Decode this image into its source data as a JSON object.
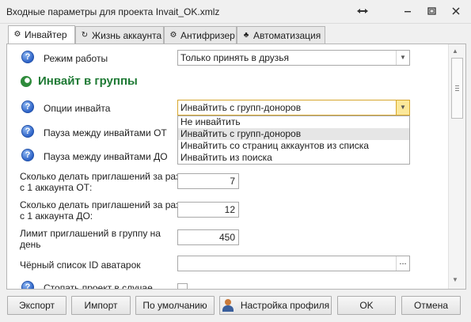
{
  "window": {
    "title": "Входные параметры для проекта Invait_OK.xmlz"
  },
  "tabs": [
    {
      "label": "Инвайтер",
      "icon": "gear-icon",
      "active": true
    },
    {
      "label": "Жизнь аккаунта",
      "icon": "refresh-icon",
      "active": false
    },
    {
      "label": "Антифризер",
      "icon": "gear-icon",
      "active": false
    },
    {
      "label": "Автоматизация",
      "icon": "hierarchy-icon",
      "active": false
    }
  ],
  "form": {
    "mode": {
      "label": "Режим работы",
      "value": "Только принять в друзья"
    },
    "section_title": "Инвайт в группы",
    "invite_options": {
      "label": "Опции инвайта",
      "value": "Инвайтить с групп-доноров",
      "dropdown_open": true,
      "options": [
        "Не инвайтить",
        "Инвайтить с групп-доноров",
        "Инвайтить со страниц аккаунтов из списка",
        "Инвайтить из поиска"
      ]
    },
    "pause_from": {
      "label": "Пауза между инвайтами ОТ"
    },
    "pause_to": {
      "label": "Пауза между инвайтами ДО"
    },
    "invites_from": {
      "label_line1": "Сколько делать приглашений за раз",
      "label_line2": "с 1 аккаунта ОТ:",
      "value": "7"
    },
    "invites_to": {
      "label_line1": "Сколько делать приглашений за раз",
      "label_line2": "с 1 аккаунта ДО:",
      "value": "12"
    },
    "group_limit": {
      "label_line1": "Лимит приглашений в группу на",
      "label_line2": "день",
      "value": "450"
    },
    "blacklist": {
      "label": "Чёрный список ID аватарок",
      "value": "",
      "button": "..."
    },
    "stop_project": {
      "label": "Стопать проект в случае"
    }
  },
  "footer": {
    "export": "Экспорт",
    "import": "Импорт",
    "defaults": "По умолчанию",
    "profile_settings": "Настройка профиля",
    "ok": "OK",
    "cancel": "Отмена"
  }
}
